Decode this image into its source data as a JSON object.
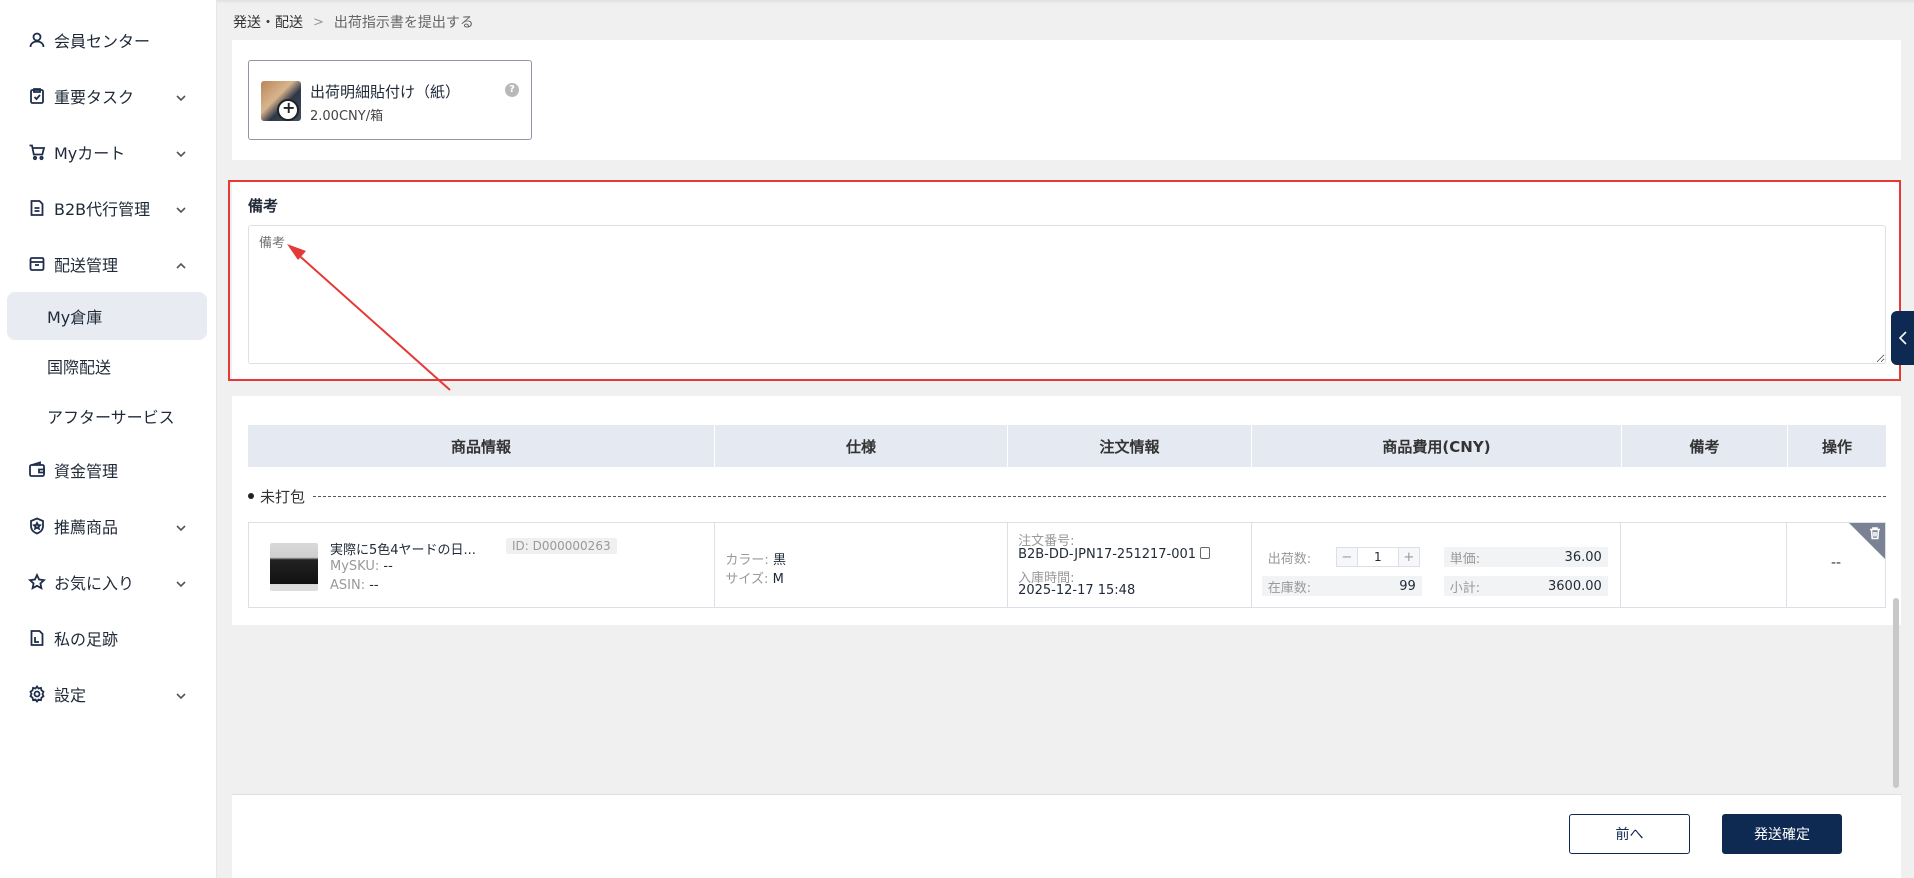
{
  "sidebar": {
    "items": [
      {
        "label": "会員センター",
        "icon": "user-icon",
        "expandable": false
      },
      {
        "label": "重要タスク",
        "icon": "clipboard-icon",
        "expandable": true
      },
      {
        "label": "Myカート",
        "icon": "cart-icon",
        "expandable": true
      },
      {
        "label": "B2B代行管理",
        "icon": "document-icon",
        "expandable": true
      },
      {
        "label": "配送管理",
        "icon": "box-icon",
        "expandable": true,
        "expanded": true
      },
      {
        "label": "資金管理",
        "icon": "wallet-icon",
        "expandable": false
      },
      {
        "label": "推薦商品",
        "icon": "shield-star-icon",
        "expandable": true
      },
      {
        "label": "お気に入り",
        "icon": "star-icon",
        "expandable": true
      },
      {
        "label": "私の足跡",
        "icon": "footprint-icon",
        "expandable": false
      },
      {
        "label": "設定",
        "icon": "gear-icon",
        "expandable": true
      }
    ],
    "sub_items": [
      {
        "label": "My倉庫",
        "active": true
      },
      {
        "label": "国際配送",
        "active": false
      },
      {
        "label": "アフターサービス",
        "active": false
      }
    ]
  },
  "breadcrumb": {
    "parent": "発送・配送",
    "separator": ">",
    "current": "出荷指示書を提出する"
  },
  "service_card": {
    "name": "出荷明細貼付け（紙）",
    "price": "2.00CNY/箱",
    "help": "?"
  },
  "remark": {
    "title": "備考",
    "placeholder": "備考"
  },
  "table": {
    "headers": [
      "商品情報",
      "仕様",
      "注文情報",
      "商品費用(CNY)",
      "備考",
      "操作"
    ],
    "group_label": "未打包",
    "rows": [
      {
        "product_name": "実際に5色4ヤードの日...",
        "product_id": "ID: D000000263",
        "mysku_label": "MySKU:",
        "mysku_value": "--",
        "asin_label": "ASIN:",
        "asin_value": "--",
        "color_label": "カラー:",
        "color_value": "黒",
        "size_label": "サイズ:",
        "size_value": "M",
        "order_no_label": "注文番号:",
        "order_no": "B2B-DD-JPN17-251217-001",
        "stock_time_label": "入庫時間:",
        "stock_time": "2025-12-17 15:48",
        "ship_qty_label": "出荷数:",
        "ship_qty": "1",
        "stock_qty_label": "在庫数:",
        "stock_qty": "99",
        "unit_price_label": "単価:",
        "unit_price": "36.00",
        "subtotal_label": "小計:",
        "subtotal": "3600.00",
        "remark": "",
        "operation": "--"
      }
    ]
  },
  "footer": {
    "prev_label": "前へ",
    "confirm_label": "発送確定"
  },
  "colors": {
    "brand_navy": "#0f2a52",
    "highlight_red": "#e53935",
    "header_bg": "#e4e9f2"
  }
}
